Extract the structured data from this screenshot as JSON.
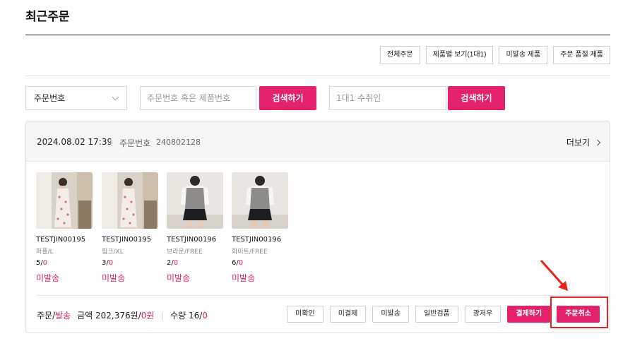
{
  "page": {
    "title": "최근주문"
  },
  "filter_tabs": [
    "전체주문",
    "제품별 보기(1대1)",
    "미발송 제품",
    "주문 품절 제품"
  ],
  "search": {
    "select_value": "주문번호",
    "input1_placeholder": "주문번호 혹은 제품번호",
    "button1": "검색하기",
    "input2_placeholder": "1대1 수취인",
    "button2": "검색하기"
  },
  "order": {
    "date": "2024.08.02 17:39",
    "order_no_label": "주문번호",
    "order_no": "240802128",
    "more": "더보기",
    "products": [
      {
        "code": "TESTJIN00195",
        "option": "퍼플/L",
        "qty_total": "5",
        "qty_done": "0",
        "status": "미발송",
        "thumb": "floral-dress"
      },
      {
        "code": "TESTJIN00195",
        "option": "핑크/XL",
        "qty_total": "3",
        "qty_done": "0",
        "status": "미발송",
        "thumb": "floral-dress"
      },
      {
        "code": "TESTJIN00196",
        "option": "브라운/FREE",
        "qty_total": "2",
        "qty_done": "0",
        "status": "미발송",
        "thumb": "knit-vest"
      },
      {
        "code": "TESTJIN00196",
        "option": "화이트/FREE",
        "qty_total": "6",
        "qty_done": "0",
        "status": "미발송",
        "thumb": "knit-vest"
      }
    ],
    "summary": {
      "order_label": "주문",
      "ship_label": "발송",
      "amount_label": "금액",
      "amount": "202,376원",
      "amount_shipped": "0원",
      "qty_label": "수량",
      "qty": "16",
      "qty_shipped": "0"
    },
    "actions": [
      "미확인",
      "미결제",
      "미발송",
      "일반검품",
      "광저우",
      "결제하기",
      "주문취소"
    ]
  },
  "colors": {
    "accent": "#e4216b",
    "highlight": "#e8231c"
  }
}
